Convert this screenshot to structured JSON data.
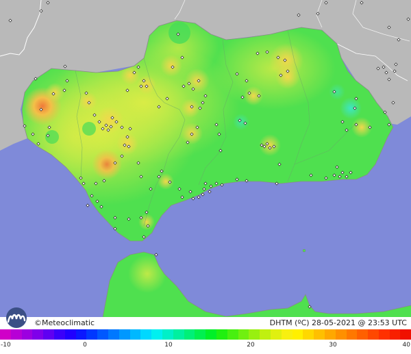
{
  "brand": {
    "copyright_symbol": "©",
    "name": "Meteoclimatic"
  },
  "variable_label": "DHTM (ºC)",
  "date": "28-05-2021",
  "at": "@",
  "time": "23:53 UTC",
  "legend": {
    "ticks": [
      "-10",
      "0",
      "10",
      "20",
      "30",
      "40"
    ],
    "min": -10,
    "max": 40,
    "colors": [
      "#d000c8",
      "#b700d6",
      "#9c00e0",
      "#7f00ea",
      "#5f00f2",
      "#3a00fa",
      "#2000ff",
      "#0a18ff",
      "#0038ff",
      "#0058ff",
      "#0078ff",
      "#0098ff",
      "#00b8ff",
      "#00d8ff",
      "#00f0f0",
      "#00f0c8",
      "#00f0a0",
      "#00f078",
      "#00f050",
      "#00f028",
      "#20f010",
      "#48f010",
      "#70f010",
      "#98f010",
      "#c0f010",
      "#e0f010",
      "#f8f010",
      "#fff000",
      "#ffd800",
      "#ffc000",
      "#ffa800",
      "#ff9000",
      "#ff7800",
      "#ff6000",
      "#ff4800",
      "#ff3000",
      "#f82000",
      "#f01000"
    ]
  },
  "map_colors": {
    "sea": "#7f8ad9",
    "land_out": "#b9b9b9",
    "region_base": "#4fe04f",
    "warm": "#c8ee4a",
    "hot": "#f0df4a"
  }
}
